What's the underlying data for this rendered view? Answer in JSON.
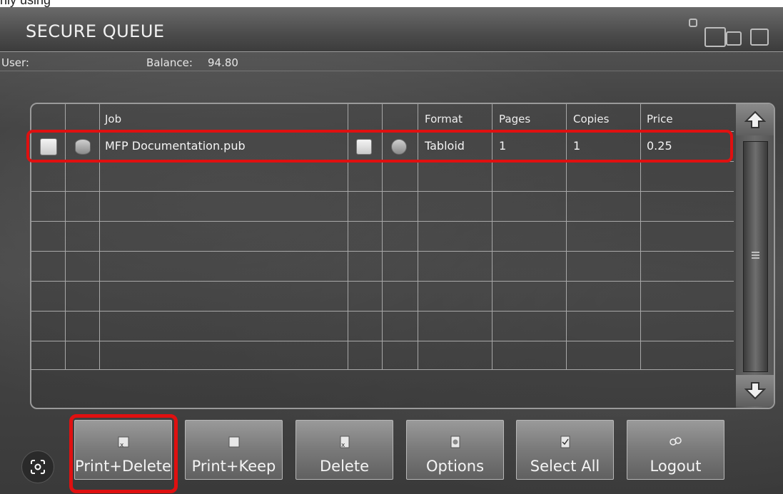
{
  "app": {
    "title": "SECURE QUEUE"
  },
  "top_strip_text": "nly using",
  "user_bar": {
    "user_label": "User:",
    "balance_label": "Balance:",
    "balance_value": "94.80"
  },
  "table": {
    "headers": {
      "job": "Job",
      "format": "Format",
      "pages": "Pages",
      "copies": "Copies",
      "price": "Price"
    },
    "rows": [
      {
        "job": "MFP Documentation.pub",
        "format": "Tabloid",
        "pages": "1",
        "copies": "1",
        "price": "0.25"
      }
    ]
  },
  "buttons": {
    "print_delete": "Print+Delete",
    "print_keep": "Print+Keep",
    "delete": "Delete",
    "options": "Options",
    "select_all": "Select All",
    "logout": "Logout"
  },
  "icons": {
    "scroll_up": "arrow-up-icon",
    "scroll_down": "arrow-down-icon",
    "scroll_grip": "grip-icon",
    "lens": "google-lens-icon"
  },
  "colors": {
    "highlight": "#e01010",
    "text": "#f4f4f4"
  }
}
